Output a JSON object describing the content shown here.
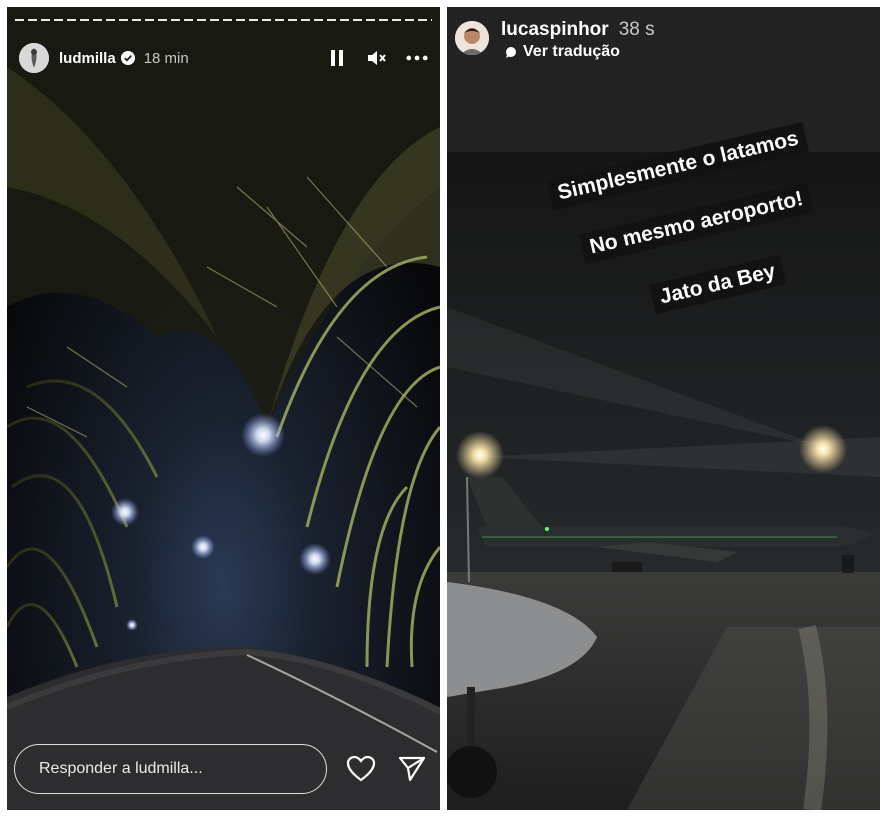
{
  "left_story": {
    "username": "ludmilla",
    "verified": true,
    "time": "18 min",
    "icons": {
      "pause": "pause-icon",
      "mute": "mute-icon",
      "more": "more-icon",
      "verified": "verified-badge-icon"
    },
    "reply_placeholder": "Responder a ludmilla...",
    "actions": {
      "like": "heart-icon",
      "share": "send-icon"
    },
    "photo": "night road through bamboo tunnel with street lights"
  },
  "right_story": {
    "username": "lucaspinhor",
    "time": "38 s",
    "translate_label": "Ver tradução",
    "stickers": [
      "Simplesmente o latamos",
      "No mesmo aeroporto!",
      "Jato da Bey"
    ],
    "photo": "private jet on wet airport apron at night"
  },
  "colors": {
    "sticker_bg": "#121212",
    "text": "#ffffff"
  }
}
